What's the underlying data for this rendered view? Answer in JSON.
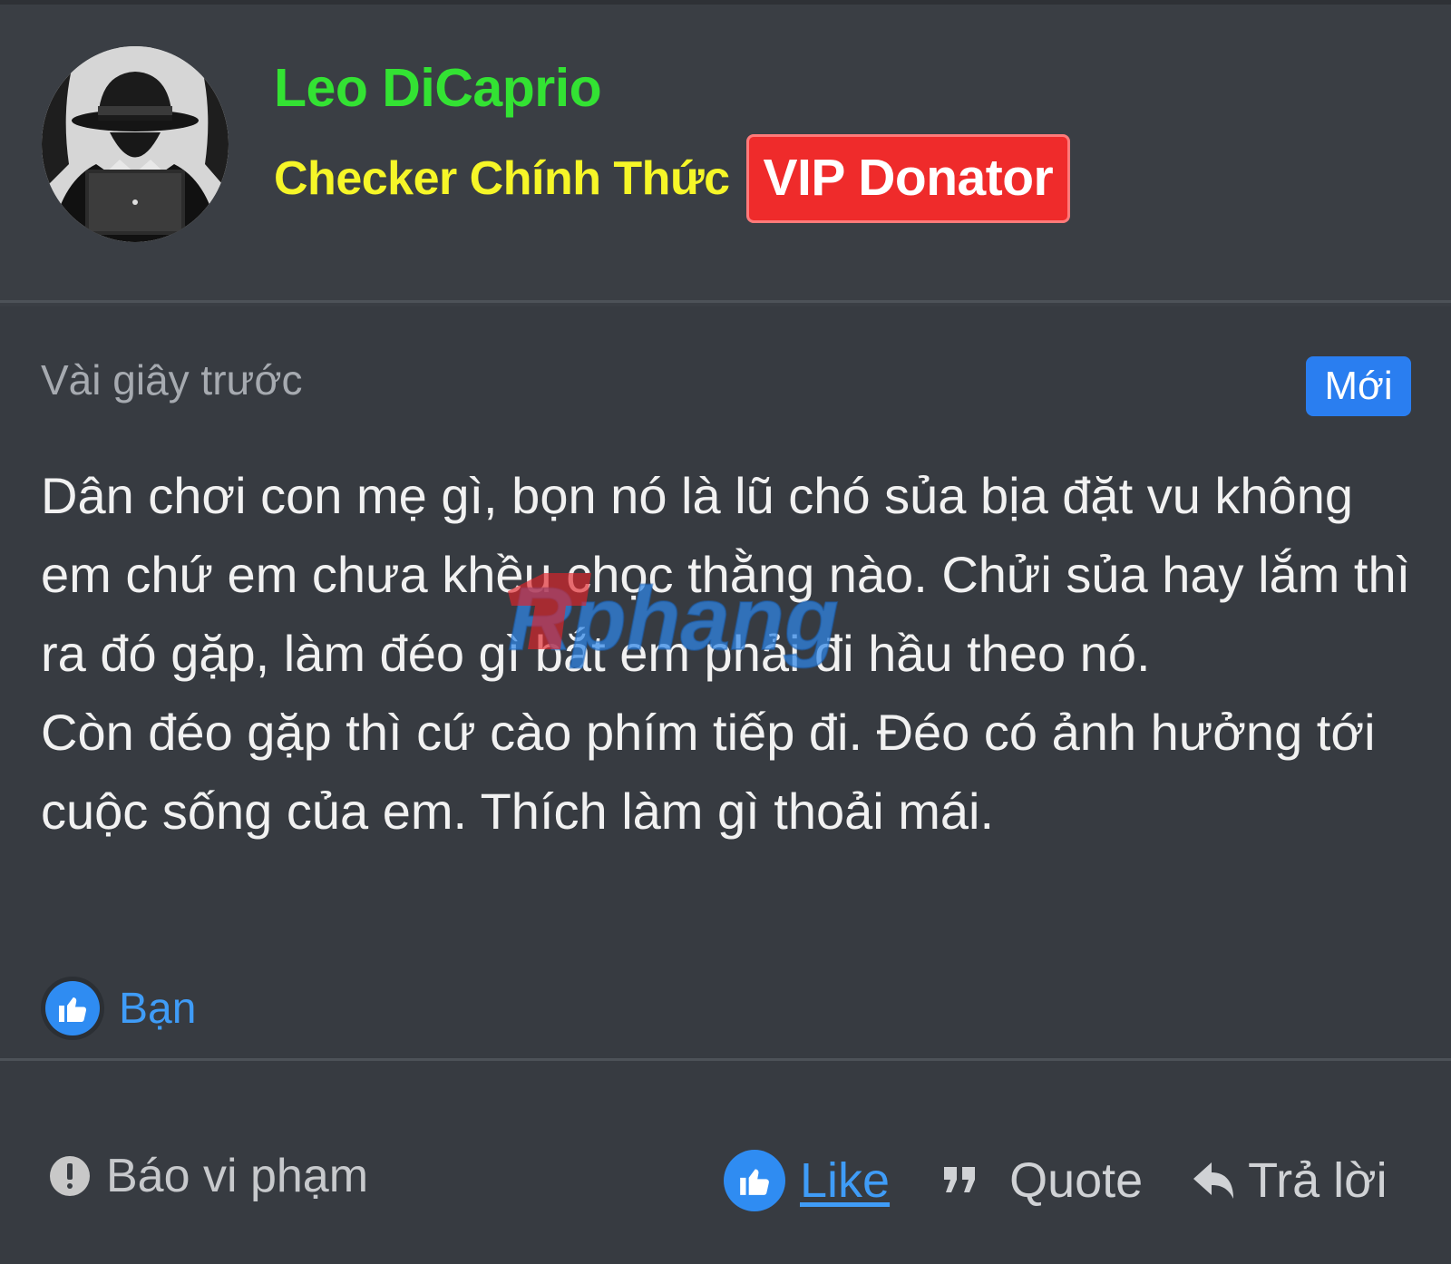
{
  "post": {
    "author": {
      "name": "Leo DiCaprio",
      "title": "Checker Chính Thức",
      "badge": "VIP Donator",
      "avatar_icon": "spy-hacker-avatar"
    },
    "time": "Vài giây trước",
    "new_badge": "Mới",
    "message_lines": [
      "Dân chơi con mẹ gì, bọn nó là lũ chó sủa bịa đặt vu không em chứ em chưa khều chọc thằng nào. Chửi sủa hay lắm thì ra đó gặp, làm đéo gì bắt em phải đi hầu theo nó.",
      "Còn đéo gặp thì cứ cào phím tiếp đi. Đéo có ảnh hưởng tới cuộc sống của em. Thích làm gì thoải mái."
    ],
    "reactions": {
      "icon": "thumbs-up-icon",
      "label": "Bạn"
    }
  },
  "watermark": {
    "text": "Rphang"
  },
  "actions": {
    "report": "Báo vi phạm",
    "like": "Like",
    "quote": "Quote",
    "reply": "Trả lời"
  },
  "colors": {
    "username": "#33e233",
    "user_title": "#f6f628",
    "vip_badge": "#ef2b2b",
    "new_badge": "#2a7ef0",
    "accent_blue": "#3f9cf7",
    "background": "#373b41"
  }
}
